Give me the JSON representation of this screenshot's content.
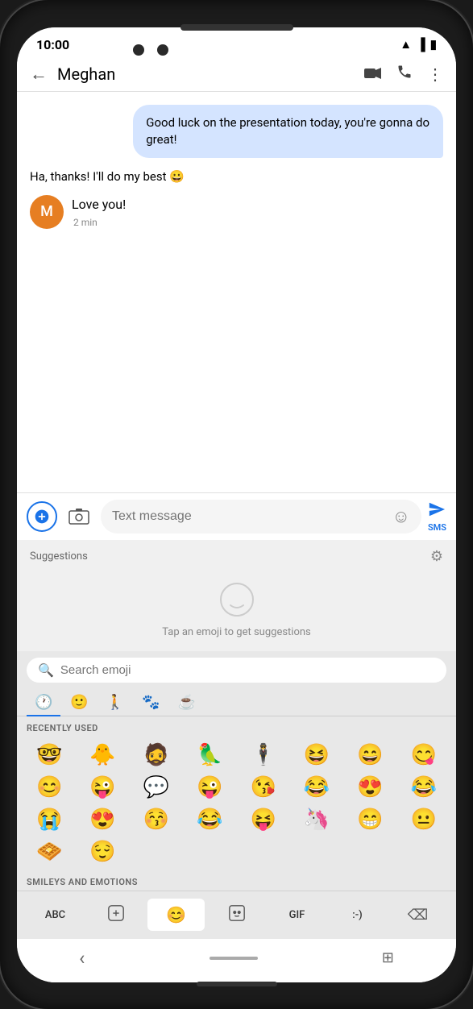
{
  "phone": {
    "status_bar": {
      "time": "10:00"
    },
    "header": {
      "back_label": "←",
      "contact_name": "Meghan",
      "video_icon": "📹",
      "phone_icon": "📞",
      "more_icon": "⋮"
    },
    "chat": {
      "sent_message": "Good luck on the presentation today, you're gonna do great!",
      "received_messages": [
        {
          "id": 1,
          "text": "Ha, thanks! I'll do my best 😀"
        },
        {
          "id": 2,
          "text": "Love you!",
          "avatar_letter": "M",
          "time": "2 min"
        }
      ]
    },
    "input": {
      "placeholder": "Text message",
      "sms_label": "SMS",
      "plus_icon": "+",
      "photo_icon": "📷",
      "emoji_icon": "☺",
      "send_icon": "➤"
    },
    "suggestions": {
      "label": "Suggestions",
      "hint": "Tap an emoji to get suggestions",
      "gear_icon": "⚙"
    },
    "emoji_keyboard": {
      "search_placeholder": "Search emoji",
      "categories": [
        {
          "id": "recent",
          "icon": "🕐",
          "active": true
        },
        {
          "id": "smiley",
          "icon": "🙂",
          "active": false
        },
        {
          "id": "person",
          "icon": "🚶",
          "active": false
        },
        {
          "id": "nature",
          "icon": "🐾",
          "active": false
        },
        {
          "id": "food",
          "icon": "☕",
          "active": false
        }
      ],
      "recently_used_label": "RECENTLY USED",
      "recently_used": [
        "🤓",
        "🐥",
        "🧔",
        "🦜",
        "🕴",
        "😆",
        "😄",
        "😋",
        "😊",
        "😜",
        "💬",
        "😜",
        "😘",
        "😂",
        "😍",
        "😂",
        "😭",
        "😍",
        "😚",
        "😂",
        "😝",
        "🦄",
        "😁",
        "😐",
        "🧇",
        "😌"
      ],
      "smileys_label": "SMILEYS AND EMOTIONS",
      "keyboard_bottom": {
        "abc_label": "ABC",
        "sticker_icon": "🖼",
        "emoji_icon": "😊",
        "kaomoji_icon": "😶",
        "gif_label": "GIF",
        "text_face_label": ":-)",
        "delete_icon": "⌫"
      }
    },
    "nav_bar": {
      "back_icon": "‹",
      "home_pill": "",
      "grid_icon": "⊞"
    }
  }
}
